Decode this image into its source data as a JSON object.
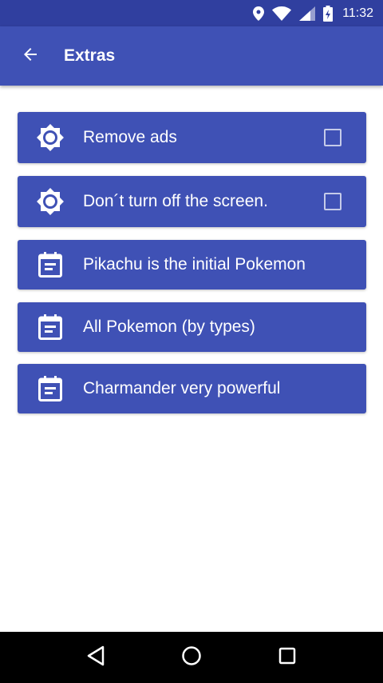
{
  "status_bar": {
    "time": "11:32",
    "icons": [
      "location-icon",
      "wifi-icon",
      "signal-icon",
      "battery-charging-icon"
    ]
  },
  "app_bar": {
    "title": "Extras",
    "back_icon": "arrow-back-icon"
  },
  "items": [
    {
      "label": "Remove ads",
      "icon": "brightness-icon",
      "has_checkbox": true,
      "checked": false
    },
    {
      "label": "Don´t turn off the screen.",
      "icon": "brightness-icon",
      "has_checkbox": true,
      "checked": false
    },
    {
      "label": "Pikachu is the initial Pokemon",
      "icon": "event-note-icon",
      "has_checkbox": false
    },
    {
      "label": "All Pokemon (by types)",
      "icon": "event-note-icon",
      "has_checkbox": false
    },
    {
      "label": "Charmander very powerful",
      "icon": "event-note-icon",
      "has_checkbox": false
    }
  ],
  "nav_bar": {
    "buttons": [
      "back-triangle-icon",
      "home-circle-icon",
      "recents-square-icon"
    ]
  },
  "colors": {
    "primary": "#3f51b5",
    "primary_dark": "#303f9f",
    "text": "#ffffff"
  }
}
